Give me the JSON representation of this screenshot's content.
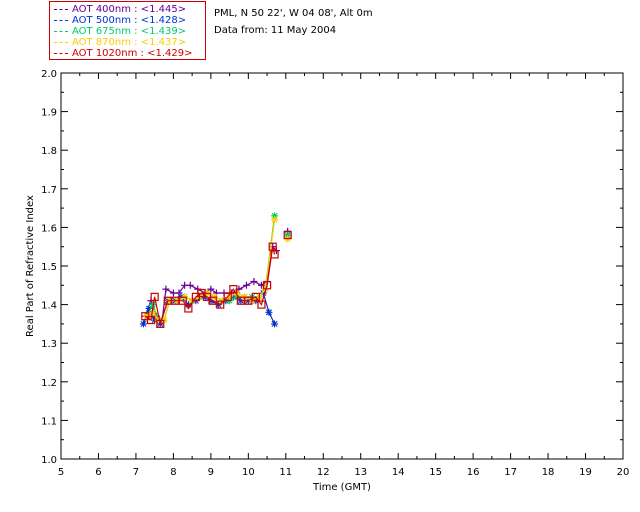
{
  "legend": [
    {
      "label": "AOT  400nm : <1.445>",
      "color": "#660099"
    },
    {
      "label": "AOT  500nm : <1.428>",
      "color": "#0033cc"
    },
    {
      "label": "AOT  675nm : <1.439>",
      "color": "#00cc66"
    },
    {
      "label": "AOT  870nm : <1.437>",
      "color": "#ffcc00"
    },
    {
      "label": "AOT 1020nm : <1.429>",
      "color": "#cc0000"
    }
  ],
  "info": {
    "site": "PML, N 50 22', W 04 08', Alt 0m",
    "date": "Data from: 11 May 2004"
  },
  "chart_data": {
    "type": "line",
    "xlabel": "Time (GMT)",
    "ylabel": "Real Part of Refractive Index",
    "xlim": [
      5,
      20
    ],
    "ylim": [
      1.0,
      2.0
    ],
    "xticks": [
      5,
      6,
      7,
      8,
      9,
      10,
      11,
      12,
      13,
      14,
      15,
      16,
      17,
      18,
      19,
      20
    ],
    "yticks": [
      "1.0",
      "1.1",
      "1.2",
      "1.3",
      "1.4",
      "1.5",
      "1.6",
      "1.7",
      "1.8",
      "1.9",
      "2.0"
    ],
    "series": [
      {
        "name": "AOT  400nm",
        "color": "#660099",
        "marker": "plus",
        "points": [
          [
            7.25,
            1.37
          ],
          [
            7.4,
            1.41
          ],
          [
            7.55,
            1.37
          ],
          [
            7.7,
            1.36
          ],
          [
            7.8,
            1.44
          ],
          [
            8.0,
            1.43
          ],
          [
            8.15,
            1.43
          ],
          [
            8.3,
            1.45
          ],
          [
            8.45,
            1.45
          ],
          [
            8.65,
            1.44
          ],
          [
            8.85,
            1.43
          ],
          [
            9.0,
            1.44
          ],
          [
            9.15,
            1.43
          ],
          [
            9.35,
            1.43
          ],
          [
            9.55,
            1.43
          ],
          [
            9.75,
            1.44
          ],
          [
            9.95,
            1.45
          ],
          [
            10.15,
            1.46
          ],
          [
            10.35,
            1.45
          ],
          [
            10.5,
            1.46
          ],
          [
            10.65,
            1.55
          ],
          [
            10.75,
            1.54
          ]
        ],
        "isolated": [
          [
            11.05,
            1.59
          ]
        ]
      },
      {
        "name": "AOT  500nm",
        "color": "#0033cc",
        "marker": "star",
        "points": [
          [
            7.2,
            1.35
          ],
          [
            7.35,
            1.39
          ],
          [
            7.5,
            1.36
          ],
          [
            7.65,
            1.35
          ],
          [
            7.85,
            1.41
          ],
          [
            8.05,
            1.41
          ],
          [
            8.2,
            1.42
          ],
          [
            8.4,
            1.4
          ],
          [
            8.6,
            1.41
          ],
          [
            8.8,
            1.42
          ],
          [
            9.0,
            1.41
          ],
          [
            9.2,
            1.4
          ],
          [
            9.4,
            1.41
          ],
          [
            9.6,
            1.42
          ],
          [
            9.8,
            1.41
          ],
          [
            10.0,
            1.41
          ],
          [
            10.2,
            1.41
          ],
          [
            10.4,
            1.43
          ],
          [
            10.55,
            1.38
          ],
          [
            10.7,
            1.35
          ]
        ],
        "isolated": [
          [
            11.05,
            1.58
          ]
        ]
      },
      {
        "name": "AOT  675nm",
        "color": "#00cc66",
        "marker": "star",
        "points": [
          [
            7.3,
            1.37
          ],
          [
            7.45,
            1.4
          ],
          [
            7.6,
            1.36
          ],
          [
            7.75,
            1.36
          ],
          [
            7.9,
            1.41
          ],
          [
            8.1,
            1.41
          ],
          [
            8.3,
            1.42
          ],
          [
            8.5,
            1.41
          ],
          [
            8.7,
            1.42
          ],
          [
            8.9,
            1.43
          ],
          [
            9.1,
            1.42
          ],
          [
            9.3,
            1.41
          ],
          [
            9.5,
            1.41
          ],
          [
            9.7,
            1.42
          ],
          [
            9.9,
            1.42
          ],
          [
            10.1,
            1.42
          ],
          [
            10.3,
            1.42
          ],
          [
            10.45,
            1.44
          ],
          [
            10.7,
            1.63
          ]
        ],
        "isolated": [
          [
            11.05,
            1.58
          ]
        ]
      },
      {
        "name": "AOT  870nm",
        "color": "#ffcc00",
        "marker": "asterisk",
        "points": [
          [
            7.3,
            1.37
          ],
          [
            7.45,
            1.38
          ],
          [
            7.6,
            1.36
          ],
          [
            7.75,
            1.36
          ],
          [
            7.9,
            1.41
          ],
          [
            8.1,
            1.41
          ],
          [
            8.3,
            1.42
          ],
          [
            8.5,
            1.41
          ],
          [
            8.7,
            1.42
          ],
          [
            8.9,
            1.43
          ],
          [
            9.1,
            1.42
          ],
          [
            9.3,
            1.41
          ],
          [
            9.5,
            1.42
          ],
          [
            9.7,
            1.43
          ],
          [
            9.9,
            1.42
          ],
          [
            10.1,
            1.41
          ],
          [
            10.3,
            1.42
          ],
          [
            10.45,
            1.44
          ],
          [
            10.7,
            1.62
          ]
        ],
        "isolated": [
          [
            11.05,
            1.57
          ]
        ]
      },
      {
        "name": "AOT 1020nm",
        "color": "#cc0000",
        "marker": "square",
        "points": [
          [
            7.25,
            1.37
          ],
          [
            7.4,
            1.36
          ],
          [
            7.5,
            1.42
          ],
          [
            7.65,
            1.35
          ],
          [
            7.85,
            1.41
          ],
          [
            8.05,
            1.41
          ],
          [
            8.25,
            1.41
          ],
          [
            8.4,
            1.39
          ],
          [
            8.6,
            1.42
          ],
          [
            8.75,
            1.43
          ],
          [
            8.9,
            1.42
          ],
          [
            9.05,
            1.41
          ],
          [
            9.25,
            1.4
          ],
          [
            9.45,
            1.42
          ],
          [
            9.6,
            1.44
          ],
          [
            9.8,
            1.41
          ],
          [
            10.0,
            1.41
          ],
          [
            10.2,
            1.42
          ],
          [
            10.35,
            1.4
          ],
          [
            10.5,
            1.45
          ],
          [
            10.65,
            1.55
          ],
          [
            10.7,
            1.53
          ]
        ],
        "isolated": [
          [
            11.05,
            1.58
          ]
        ]
      }
    ]
  }
}
